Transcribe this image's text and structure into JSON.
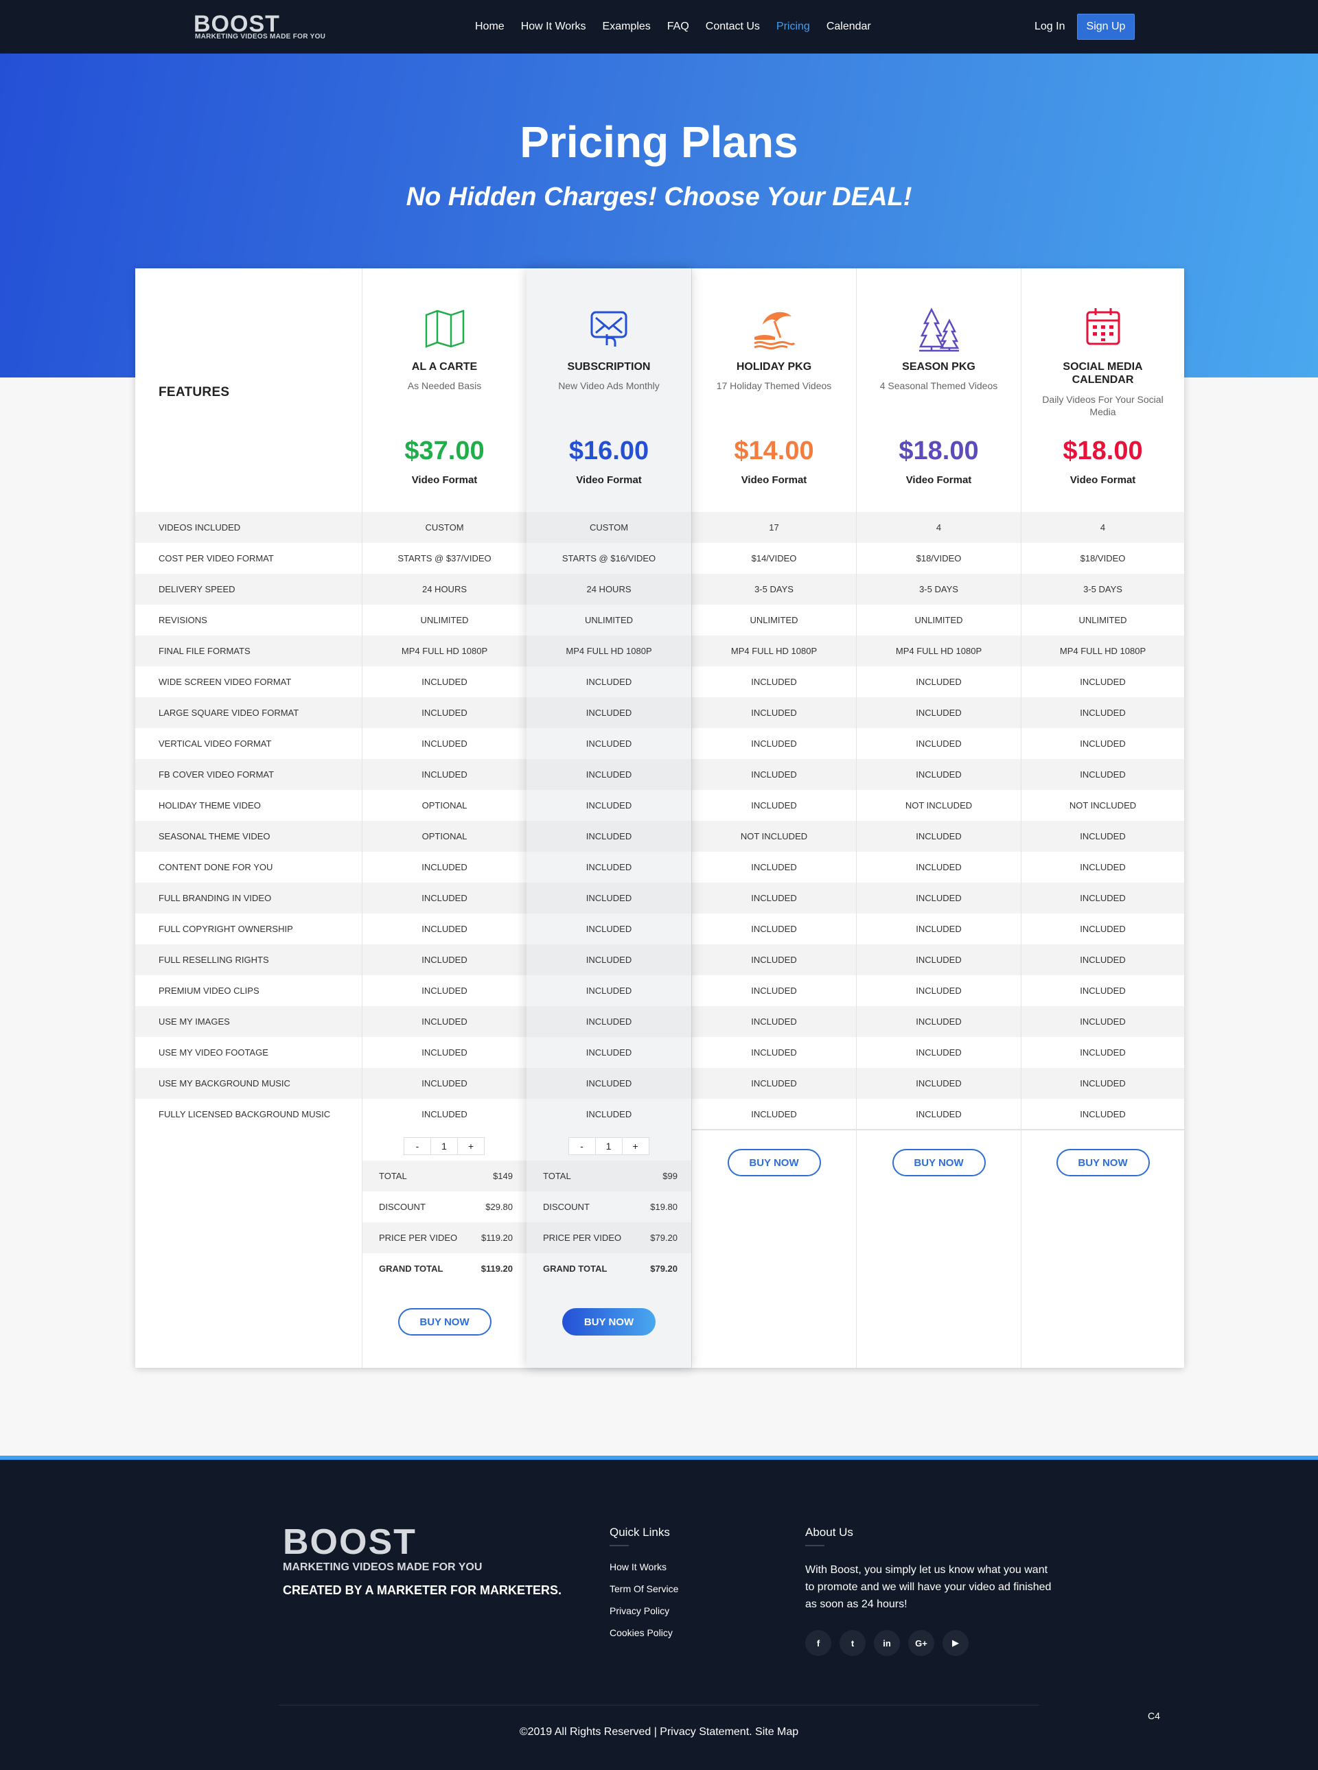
{
  "nav": {
    "logo_text": "BOOST",
    "logo_tagline": "MARKETING VIDEOS MADE FOR YOU",
    "links": [
      {
        "label": "Home"
      },
      {
        "label": "How It Works"
      },
      {
        "label": "Examples"
      },
      {
        "label": "FAQ"
      },
      {
        "label": "Contact Us"
      },
      {
        "label": "Pricing",
        "active": true
      },
      {
        "label": "Calendar"
      }
    ],
    "login": "Log In",
    "signup": "Sign Up",
    "active_color": "#3ea0f2"
  },
  "hero": {
    "title": "Pricing Plans",
    "subtitle": "No Hidden Charges! Choose Your DEAL!"
  },
  "features": {
    "title": "FEATURES",
    "rows": [
      "VIDEOS INCLUDED",
      "COST PER VIDEO FORMAT",
      "DELIVERY SPEED",
      "REVISIONS",
      "FINAL FILE FORMATS",
      "WIDE SCREEN VIDEO FORMAT",
      "LARGE SQUARE VIDEO FORMAT",
      "VERTICAL VIDEO FORMAT",
      "FB COVER VIDEO FORMAT",
      "HOLIDAY THEME VIDEO",
      "SEASONAL THEME VIDEO",
      "CONTENT DONE FOR YOU",
      "FULL BRANDING IN VIDEO",
      "FULL COPYRIGHT OWNERSHIP",
      "FULL RESELLING RIGHTS",
      "PREMIUM VIDEO CLIPS",
      "USE MY IMAGES",
      "USE MY VIDEO FOOTAGE",
      "USE MY BACKGROUND MUSIC",
      "FULLY LICENSED BACKGROUND MUSIC"
    ]
  },
  "plans": [
    {
      "icon": "map-icon",
      "color": "#1fae4a",
      "name": "AL A CARTE",
      "sub": "As Needed Basis",
      "price": "$37.00",
      "format": "Video Format",
      "values": [
        "CUSTOM",
        "STARTS @ $37/VIDEO",
        "24 HOURS",
        "UNLIMITED",
        "MP4 FULL HD 1080P",
        "INCLUDED",
        "INCLUDED",
        "INCLUDED",
        "INCLUDED",
        "OPTIONAL",
        "OPTIONAL",
        "INCLUDED",
        "INCLUDED",
        "INCLUDED",
        "INCLUDED",
        "INCLUDED",
        "INCLUDED",
        "INCLUDED",
        "INCLUDED",
        "INCLUDED"
      ],
      "stepper": {
        "minus": "-",
        "value": "1",
        "plus": "+"
      },
      "totals": [
        {
          "k": "TOTAL",
          "v": "$149"
        },
        {
          "k": "DISCOUNT",
          "v": "$29.80"
        },
        {
          "k": "PRICE PER VIDEO",
          "v": "$119.20"
        },
        {
          "k": "GRAND TOTAL",
          "v": "$119.20"
        }
      ],
      "buy": "BUY NOW"
    },
    {
      "icon": "mail-touch-icon",
      "color": "#2450d6",
      "name": "SUBSCRIPTION",
      "sub": "New Video Ads Monthly",
      "price": "$16.00",
      "format": "Video Format",
      "values": [
        "CUSTOM",
        "STARTS @ $16/VIDEO",
        "24 HOURS",
        "UNLIMITED",
        "MP4 FULL HD 1080P",
        "INCLUDED",
        "INCLUDED",
        "INCLUDED",
        "INCLUDED",
        "INCLUDED",
        "INCLUDED",
        "INCLUDED",
        "INCLUDED",
        "INCLUDED",
        "INCLUDED",
        "INCLUDED",
        "INCLUDED",
        "INCLUDED",
        "INCLUDED",
        "INCLUDED"
      ],
      "stepper": {
        "minus": "-",
        "value": "1",
        "plus": "+"
      },
      "totals": [
        {
          "k": "TOTAL",
          "v": "$99"
        },
        {
          "k": "DISCOUNT",
          "v": "$19.80"
        },
        {
          "k": "PRICE PER VIDEO",
          "v": "$79.20"
        },
        {
          "k": "GRAND TOTAL",
          "v": "$79.20"
        }
      ],
      "buy": "BUY NOW"
    },
    {
      "icon": "beach-umbrella-icon",
      "color": "#f47c3c",
      "name": "HOLIDAY PKG",
      "sub": "17 Holiday Themed Videos",
      "price": "$14.00",
      "format": "Video Format",
      "values": [
        "17",
        "$14/VIDEO",
        "3-5 DAYS",
        "UNLIMITED",
        "MP4 FULL HD 1080P",
        "INCLUDED",
        "INCLUDED",
        "INCLUDED",
        "INCLUDED",
        "INCLUDED",
        "NOT INCLUDED",
        "INCLUDED",
        "INCLUDED",
        "INCLUDED",
        "INCLUDED",
        "INCLUDED",
        "INCLUDED",
        "INCLUDED",
        "INCLUDED",
        "INCLUDED"
      ],
      "buy": "BUY NOW"
    },
    {
      "icon": "pine-trees-icon",
      "color": "#5b4bbd",
      "name": "SEASON PKG",
      "sub": "4 Seasonal Themed Videos",
      "price": "$18.00",
      "format": "Video Format",
      "values": [
        "4",
        "$18/VIDEO",
        "3-5 DAYS",
        "UNLIMITED",
        "MP4 FULL HD 1080P",
        "INCLUDED",
        "INCLUDED",
        "INCLUDED",
        "INCLUDED",
        "NOT INCLUDED",
        "INCLUDED",
        "INCLUDED",
        "INCLUDED",
        "INCLUDED",
        "INCLUDED",
        "INCLUDED",
        "INCLUDED",
        "INCLUDED",
        "INCLUDED",
        "INCLUDED"
      ],
      "buy": "BUY NOW"
    },
    {
      "icon": "calendar-icon",
      "color": "#e8113a",
      "name": "SOCIAL MEDIA CALENDAR",
      "sub": "Daily Videos For Your Social Media",
      "price": "$18.00",
      "format": "Video Format",
      "values": [
        "4",
        "$18/VIDEO",
        "3-5 DAYS",
        "UNLIMITED",
        "MP4 FULL HD 1080P",
        "INCLUDED",
        "INCLUDED",
        "INCLUDED",
        "INCLUDED",
        "NOT INCLUDED",
        "INCLUDED",
        "INCLUDED",
        "INCLUDED",
        "INCLUDED",
        "INCLUDED",
        "INCLUDED",
        "INCLUDED",
        "INCLUDED",
        "INCLUDED",
        "INCLUDED"
      ],
      "buy": "BUY NOW"
    }
  ],
  "footer": {
    "logo_text": "BOOST",
    "logo_tagline": "MARKETING VIDEOS MADE FOR YOU",
    "slogan": "CREATED BY A MARKETER FOR MARKETERS.",
    "quick_links_title": "Quick Links",
    "quick_links": [
      "How It Works",
      "Term Of Service",
      "Privacy Policy",
      "Cookies Policy"
    ],
    "about_title": "About Us",
    "about_text": "With Boost, you simply let us know what you want to promote and we will have your video ad finished as soon as 24 hours!",
    "social": [
      {
        "icon": "facebook-icon",
        "glyph": "f"
      },
      {
        "icon": "twitter-icon",
        "glyph": "t"
      },
      {
        "icon": "linkedin-icon",
        "glyph": "in"
      },
      {
        "icon": "google-plus-icon",
        "glyph": "G+"
      },
      {
        "icon": "youtube-icon",
        "glyph": "▶"
      }
    ],
    "copyright": "©2019 All Rights Reserved | Privacy Statement. Site Map",
    "corner_tag": "C4"
  }
}
